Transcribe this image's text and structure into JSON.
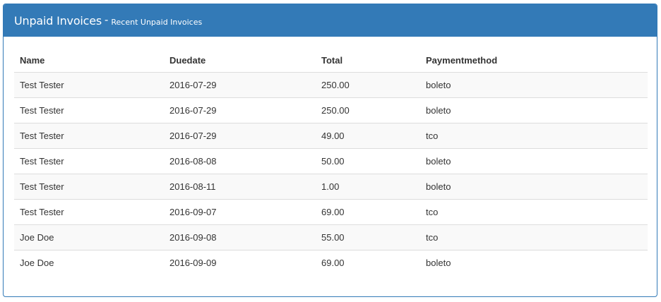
{
  "panel": {
    "title": "Unpaid Invoices",
    "separator": "-",
    "subtitle": "Recent Unpaid Invoices",
    "header_color": "#337ab7"
  },
  "table": {
    "columns": [
      "Name",
      "Duedate",
      "Total",
      "Paymentmethod"
    ],
    "rows": [
      [
        "Test Tester",
        "2016-07-29",
        "250.00",
        "boleto"
      ],
      [
        "Test Tester",
        "2016-07-29",
        "250.00",
        "boleto"
      ],
      [
        "Test Tester",
        "2016-07-29",
        "49.00",
        "tco"
      ],
      [
        "Test Tester",
        "2016-08-08",
        "50.00",
        "boleto"
      ],
      [
        "Test Tester",
        "2016-08-11",
        "1.00",
        "boleto"
      ],
      [
        "Test Tester",
        "2016-09-07",
        "69.00",
        "tco"
      ],
      [
        "Joe Doe",
        "2016-09-08",
        "55.00",
        "tco"
      ],
      [
        "Joe Doe",
        "2016-09-09",
        "69.00",
        "boleto"
      ]
    ]
  }
}
